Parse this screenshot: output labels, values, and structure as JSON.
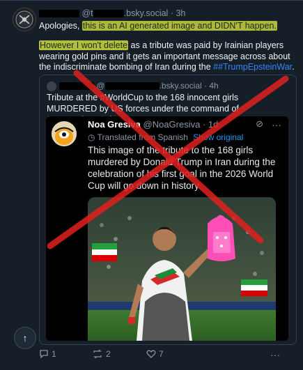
{
  "post": {
    "handle_suffix": "@t",
    "handle_domain": ".bsky.social",
    "time": "3h",
    "line1_pre": "Apologies, ",
    "line1_hl": "this is an AI generated image and DIDN'T happen.",
    "line2_hl": "However I won't delete",
    "line2_rest": " as a tribute was paid by Irainian players wearing gold pins and it gets an important message across about the indiscriminate bombing of Iran during the ",
    "line2_tag": "##TrumpEpsteinWar",
    "line2_end": "."
  },
  "quote": {
    "handle_prefix": "@",
    "handle_domain": ".bsky.social",
    "time": "4h",
    "text": "Tribute at the #WorldCup to the 168 innocent girls MURDERED by US forces under the command of #TrumpThePaedo."
  },
  "tweet": {
    "name": "Noa Gresiva",
    "handle": "@NoaGresiva",
    "time": "1d",
    "translated": "Translated from Spanish",
    "show_original": "Show original",
    "body": "This image of the tribute to the 168 girls murdered by Donald Trump in Iran during the celebration of his first goal in the 2026 World Cup will go down in history.",
    "more": "···"
  },
  "actions": {
    "replies": "1",
    "reposts": "2",
    "likes": "7"
  },
  "icons": [
    "reply-icon",
    "repost-icon",
    "heart-icon",
    "more-icon",
    "arrow-up-icon",
    "translate-icon",
    "grok-icon"
  ],
  "colors": {
    "highlight": "#cedb42",
    "link": "#2f86ff",
    "cross": "#e0201f",
    "background": "#161e27"
  }
}
